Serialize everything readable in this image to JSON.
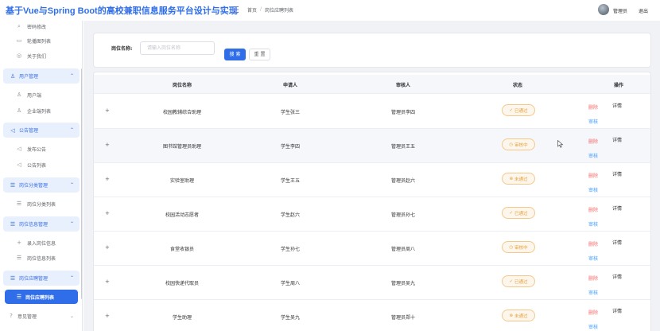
{
  "header": {
    "app_title": "基于Vue与Spring Boot的高校兼职信息服务平台设计与实现",
    "breadcrumb": [
      "首页",
      "岗位应聘列表"
    ],
    "breadcrumb_separator": "/",
    "user_name": "管理员",
    "logout_label": "退出"
  },
  "sidebar": {
    "top_items": [
      {
        "label": "密码修改",
        "icon": "search-icon"
      },
      {
        "label": "轮播图列表",
        "icon": "image-icon"
      },
      {
        "label": "关于我们",
        "icon": "info-icon"
      }
    ],
    "groups": [
      {
        "label": "用户管理",
        "icon": "users-icon",
        "items": [
          {
            "label": "用户端",
            "icon": "user-icon"
          },
          {
            "label": "企业端列表",
            "icon": "user-icon"
          }
        ]
      },
      {
        "label": "公告管理",
        "icon": "megaphone-icon",
        "items": [
          {
            "label": "发布公告",
            "icon": "megaphone-icon"
          },
          {
            "label": "公告列表",
            "icon": "megaphone-icon"
          }
        ]
      },
      {
        "label": "岗位分类管理",
        "icon": "list-icon",
        "items": [
          {
            "label": "岗位分类列表",
            "icon": "list-icon"
          }
        ]
      },
      {
        "label": "岗位信息管理",
        "icon": "list-icon",
        "items": [
          {
            "label": "录入岗位信息",
            "icon": "plus-icon"
          },
          {
            "label": "岗位信息列表",
            "icon": "list-icon"
          }
        ]
      },
      {
        "label": "岗位应聘管理",
        "icon": "list-icon",
        "items": [
          {
            "label": "岗位应聘列表",
            "icon": "list-icon",
            "active": true
          }
        ]
      }
    ],
    "bottom_item": {
      "label": "意见管理",
      "icon": "question-icon"
    }
  },
  "search": {
    "label": "岗位名称:",
    "placeholder": "请输入岗位名称",
    "search_button": "搜 索",
    "reset_button": "重 置"
  },
  "table": {
    "columns": [
      "岗位名称",
      "申请人",
      "审核人",
      "状态",
      "操作"
    ],
    "rows": [
      {
        "position": "校园教辅综合助理",
        "applicant": "学生张三",
        "reviewer": "管理员李四",
        "status": "已通过"
      },
      {
        "position": "图书馆管理员助理",
        "applicant": "学生李四",
        "reviewer": "管理员王五",
        "status": "审核中"
      },
      {
        "position": "实验室助理",
        "applicant": "学生王五",
        "reviewer": "管理员赵六",
        "status": "未通过"
      },
      {
        "position": "校园活动志愿者",
        "applicant": "学生赵六",
        "reviewer": "管理员孙七",
        "status": "已通过"
      },
      {
        "position": "食堂收银员",
        "applicant": "学生孙七",
        "reviewer": "管理员周八",
        "status": "审核中"
      },
      {
        "position": "校园快递代取员",
        "applicant": "学生周八",
        "reviewer": "管理员吴九",
        "status": "已通过"
      },
      {
        "position": "学生助理",
        "applicant": "学生吴九",
        "reviewer": "管理员郑十",
        "status": "未通过"
      }
    ],
    "actions": {
      "delete": "删除",
      "detail": "详情",
      "review": "审核"
    },
    "expand_symbol": "+"
  },
  "colors": {
    "primary": "#2f6ee8",
    "danger": "#f56c6c",
    "link": "#409eff",
    "warning": "#e6a23c"
  }
}
